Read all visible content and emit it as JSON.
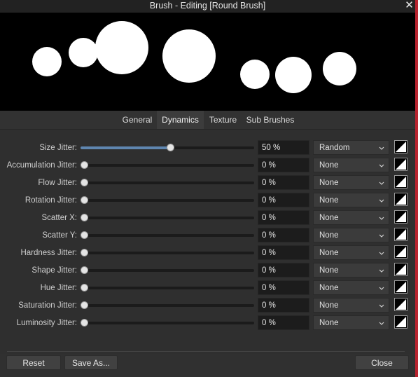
{
  "window": {
    "title": "Brush - Editing [Round Brush]",
    "close_glyph": "✕",
    "accent_color": "#5f86b0"
  },
  "tabs": [
    {
      "label": "General",
      "active": false
    },
    {
      "label": "Dynamics",
      "active": true
    },
    {
      "label": "Texture",
      "active": false
    },
    {
      "label": "Sub Brushes",
      "active": false
    }
  ],
  "dynamics": [
    {
      "label": "Size Jitter:",
      "level": 0.5,
      "value": "50 %",
      "mode": "Random"
    },
    {
      "label": "Accumulation Jitter:",
      "level": 0,
      "value": "0 %",
      "mode": "None"
    },
    {
      "label": "Flow Jitter:",
      "level": 0,
      "value": "0 %",
      "mode": "None"
    },
    {
      "label": "Rotation Jitter:",
      "level": 0,
      "value": "0 %",
      "mode": "None"
    },
    {
      "label": "Scatter X:",
      "level": 0,
      "value": "0 %",
      "mode": "None"
    },
    {
      "label": "Scatter Y:",
      "level": 0,
      "value": "0 %",
      "mode": "None"
    },
    {
      "label": "Hardness Jitter:",
      "level": 0,
      "value": "0 %",
      "mode": "None"
    },
    {
      "label": "Shape Jitter:",
      "level": 0,
      "value": "0 %",
      "mode": "None"
    },
    {
      "label": "Hue Jitter:",
      "level": 0,
      "value": "0 %",
      "mode": "None"
    },
    {
      "label": "Saturation Jitter:",
      "level": 0,
      "value": "0 %",
      "mode": "None"
    },
    {
      "label": "Luminosity Jitter:",
      "level": 0,
      "value": "0 %",
      "mode": "None"
    }
  ],
  "icons": {
    "dropdown": "chevron-down-icon",
    "pressure_curve": "pressure-curve-icon",
    "close": "close-icon"
  },
  "footer": {
    "reset_label": "Reset",
    "save_as_label": "Save As...",
    "close_label": "Close"
  }
}
